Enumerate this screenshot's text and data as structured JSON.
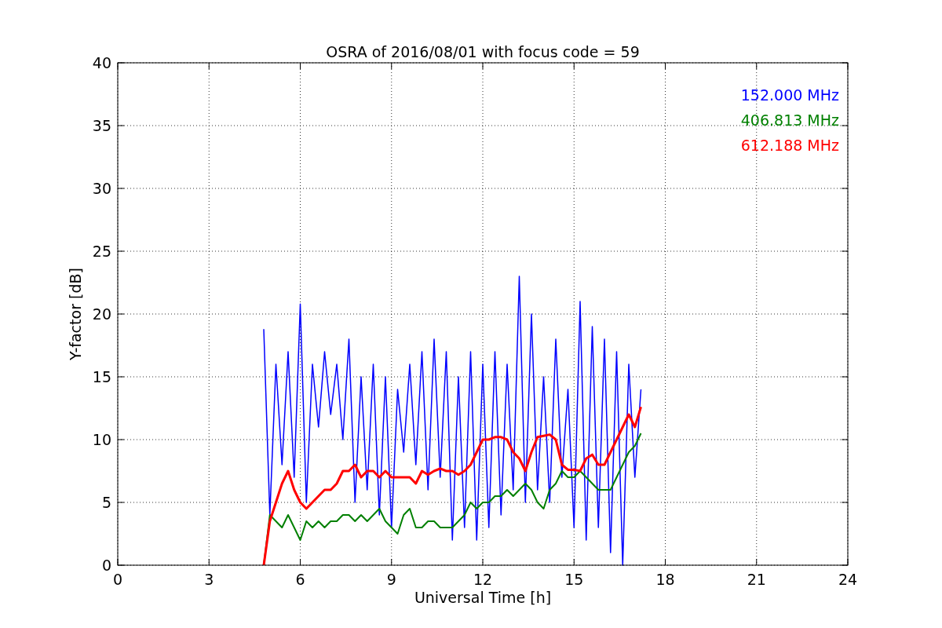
{
  "chart_data": {
    "type": "line",
    "title": "OSRA of 2016/08/01 with focus code = 59",
    "xlabel": "Universal Time [h]",
    "ylabel": "Y-factor [dB]",
    "x": [
      4.8,
      5.0,
      5.2,
      5.4,
      5.6,
      5.8,
      6.0,
      6.2,
      6.4,
      6.6,
      6.8,
      7.0,
      7.2,
      7.4,
      7.6,
      7.8,
      8.0,
      8.2,
      8.4,
      8.6,
      8.8,
      9.0,
      9.2,
      9.4,
      9.6,
      9.8,
      10.0,
      10.2,
      10.4,
      10.6,
      10.8,
      11.0,
      11.2,
      11.4,
      11.6,
      11.8,
      12.0,
      12.2,
      12.4,
      12.6,
      12.8,
      13.0,
      13.2,
      13.4,
      13.6,
      13.8,
      14.0,
      14.2,
      14.4,
      14.6,
      14.8,
      15.0,
      15.2,
      15.4,
      15.6,
      15.8,
      16.0,
      16.2,
      16.4,
      16.6,
      16.8,
      17.0,
      17.2
    ],
    "series": [
      {
        "name": "152.000 MHz",
        "color": "#0000ff",
        "values": [
          18.8,
          4,
          16,
          8,
          17,
          7,
          20.8,
          5,
          16,
          11,
          17,
          12,
          16,
          10,
          18,
          5,
          15,
          6,
          16,
          4,
          15,
          3,
          14,
          9,
          16,
          8,
          17,
          6,
          18,
          7,
          17,
          2,
          15,
          3,
          17,
          2,
          16,
          3,
          17,
          4,
          16,
          6,
          23,
          5,
          20,
          6,
          15,
          5,
          18,
          7,
          14,
          3,
          21,
          2,
          19,
          3,
          18,
          1,
          17,
          0,
          16,
          7,
          14
        ]
      },
      {
        "name": "406.813 MHz",
        "color": "#008000",
        "values": [
          0,
          4,
          3.5,
          3,
          4,
          3,
          2,
          3.5,
          3,
          3.5,
          3,
          3.5,
          3.5,
          4,
          4,
          3.5,
          4,
          3.5,
          4,
          4.5,
          3.5,
          3,
          2.5,
          4,
          4.5,
          3,
          3,
          3.5,
          3.5,
          3,
          3,
          3,
          3.5,
          4,
          5,
          4.5,
          5,
          5,
          5.5,
          5.5,
          6,
          5.5,
          6,
          6.5,
          6,
          5,
          4.5,
          6,
          6.5,
          7.5,
          7,
          7,
          7.5,
          7,
          6.5,
          6,
          6,
          6,
          7,
          8,
          9,
          9.5,
          10.5
        ]
      },
      {
        "name": "612.188 MHz",
        "color": "#ff0000",
        "values": [
          0,
          3.5,
          5,
          6.5,
          7.5,
          6,
          5,
          4.5,
          5,
          5.5,
          6,
          6,
          6.5,
          7.5,
          7.5,
          8,
          7,
          7.5,
          7.5,
          7,
          7.5,
          7,
          7,
          7,
          7,
          6.5,
          7.5,
          7.2,
          7.5,
          7.7,
          7.5,
          7.5,
          7.2,
          7.5,
          8,
          9,
          10,
          10,
          10.2,
          10.2,
          10,
          9,
          8.5,
          7.5,
          9,
          10.2,
          10.3,
          10.4,
          10,
          8,
          7.6,
          7.6,
          7.5,
          8.5,
          8.8,
          8,
          8,
          9,
          10,
          11,
          12,
          11,
          12.6
        ]
      }
    ],
    "xlim": [
      0,
      24
    ],
    "ylim": [
      0,
      40
    ],
    "xticks": [
      0,
      3,
      6,
      9,
      12,
      15,
      18,
      21,
      24
    ],
    "yticks": [
      0,
      5,
      10,
      15,
      20,
      25,
      30,
      35,
      40
    ],
    "grid": true
  }
}
